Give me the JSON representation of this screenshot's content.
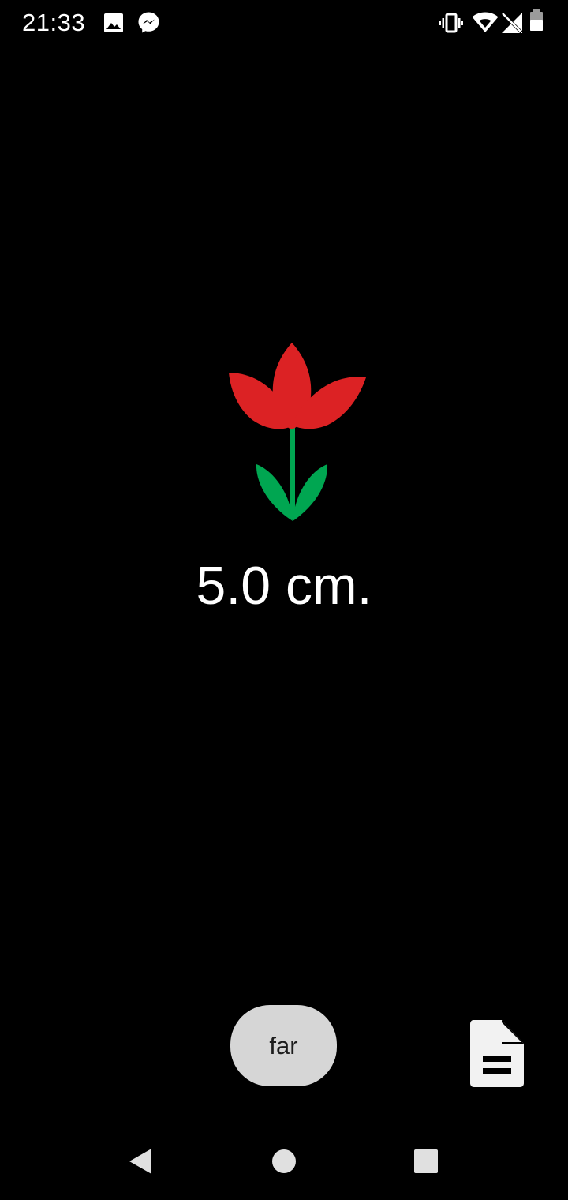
{
  "status_bar": {
    "time": "21:33",
    "left_icons": [
      "gallery-icon",
      "messenger-icon"
    ],
    "right_icons": [
      "vibrate-icon",
      "wifi-icon",
      "no-signal-icon",
      "battery-icon"
    ]
  },
  "main": {
    "measurement": "5.0 cm.",
    "image": "tulip-flower",
    "colors": {
      "petal": "#dc2224",
      "stem_leaf": "#00a651"
    }
  },
  "controls": {
    "far_label": "far",
    "document_icon": "document-icon"
  },
  "navigation": {
    "buttons": [
      "back-icon",
      "home-icon",
      "recents-icon"
    ]
  }
}
